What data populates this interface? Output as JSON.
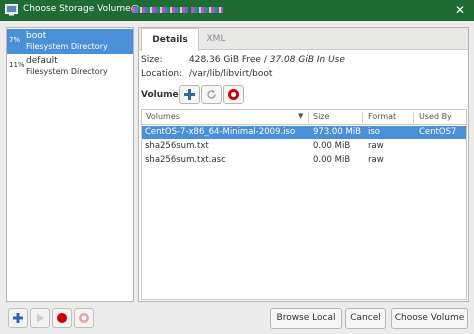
{
  "window": {
    "title": "Choose Storage Volume@",
    "app_icon": "virt-manager-icon",
    "close_icon": "close-icon",
    "title_bar_color": "#1e6b34"
  },
  "pools": [
    {
      "usage": "7%",
      "name": "boot",
      "type": "Filesystem Directory",
      "selected": true
    },
    {
      "usage": "11%",
      "name": "default",
      "type": "Filesystem Directory",
      "selected": false
    }
  ],
  "tabs": [
    {
      "label": "Details",
      "active": true
    },
    {
      "label": "XML",
      "active": false
    }
  ],
  "details": {
    "size_label": "Size:",
    "free": "428.36 GiB Free",
    "separator": " / ",
    "in_use": "37.08 GiB In Use",
    "location_label": "Location:",
    "location": "/var/lib/libvirt/boot"
  },
  "volumes": {
    "label": "Volumes",
    "toolbar_icons": [
      "add-icon",
      "refresh-icon",
      "delete-icon"
    ],
    "columns": [
      "Volumes",
      "Size",
      "Format",
      "Used By"
    ],
    "rows": [
      {
        "name": "CentOS-7-x86_64-Minimal-2009.iso",
        "size": "973.00 MiB",
        "format": "iso",
        "used_by": "CentOS7",
        "selected": true
      },
      {
        "name": "sha256sum.txt",
        "size": "0.00 MiB",
        "format": "raw",
        "used_by": "",
        "selected": false
      },
      {
        "name": "sha256sum.txt.asc",
        "size": "0.00 MiB",
        "format": "raw",
        "used_by": "",
        "selected": false
      }
    ]
  },
  "bottom": {
    "pool_icons": [
      "add-pool-icon",
      "start-pool-icon",
      "stop-pool-icon",
      "delete-pool-icon"
    ],
    "browse_local": "Browse Local",
    "cancel": "Cancel",
    "choose_volume": "Choose Volume"
  },
  "colors": {
    "selection": "#4a90d9",
    "accent_blue": "#3465a4",
    "stop_red": "#cc0000"
  }
}
